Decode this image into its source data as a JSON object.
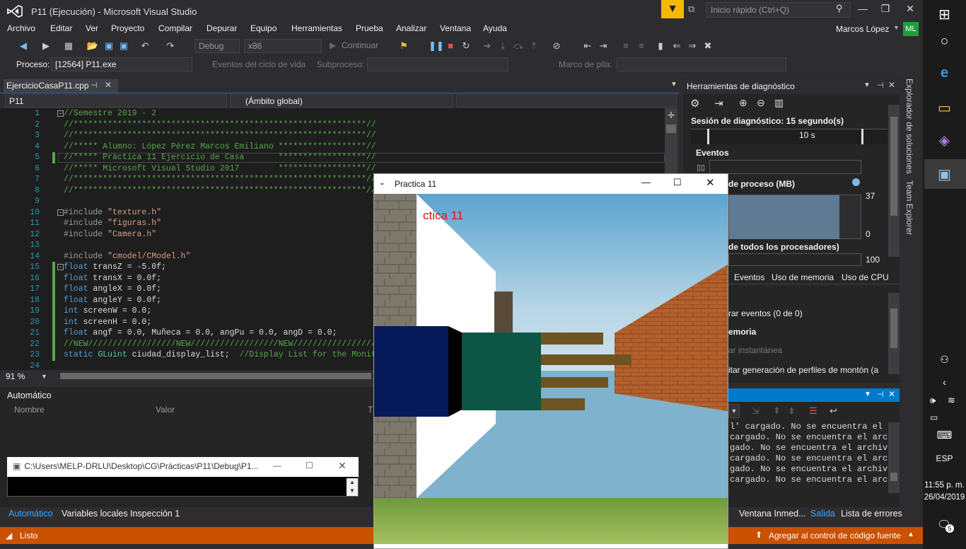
{
  "window": {
    "title": "P11 (Ejecución) - Microsoft Visual Studio",
    "quick_launch_placeholder": "Inicio rápido (Ctrl+Q)",
    "user": "Marcos López",
    "user_initials": "ML"
  },
  "menu": [
    "Archivo",
    "Editar",
    "Ver",
    "Proyecto",
    "Compilar",
    "Depurar",
    "Equipo",
    "Herramientas",
    "Prueba",
    "Analizar",
    "Ventana",
    "Ayuda"
  ],
  "toolbar": {
    "config": "Debug",
    "platform": "x86",
    "continue": "Continuar"
  },
  "process_bar": {
    "process_label": "Proceso:",
    "process_value": "[12564] P11.exe",
    "lifecycle": "Eventos del ciclo de vida",
    "thread_label": "Subproceso:",
    "stack_label": "Marco de pila:"
  },
  "editor": {
    "tab": "EjercicioCasaP11.cpp",
    "project": "P11",
    "scope": "(Ámbito global)",
    "zoom": "91 %",
    "lines": [
      {
        "n": "1",
        "t": "//Semestre 2019 - 2"
      },
      {
        "n": "2",
        "t": "//************************************************************//"
      },
      {
        "n": "3",
        "t": "//************************************************************//"
      },
      {
        "n": "4",
        "t": "//***** Alumno: López Pérez Marcos Emiliano ******************//"
      },
      {
        "n": "5",
        "t": "//***** Práctica 11 Ejercicio de Casa       ******************//"
      },
      {
        "n": "6",
        "t": "//***** Microsoft Visual Studio 2017        ******************//"
      },
      {
        "n": "7",
        "t": "//************************************************************//"
      },
      {
        "n": "8",
        "t": "//************************************************************//"
      },
      {
        "n": "9",
        "t": ""
      },
      {
        "n": "10",
        "t": "#include \"texture.h\""
      },
      {
        "n": "11",
        "t": "#include \"figuras.h\""
      },
      {
        "n": "12",
        "t": "#include \"Camera.h\""
      },
      {
        "n": "13",
        "t": ""
      },
      {
        "n": "14",
        "t": "#include \"cmodel/CModel.h\""
      },
      {
        "n": "15",
        "t": "float transZ = -5.0f;"
      },
      {
        "n": "16",
        "t": "float transX = 0.0f;"
      },
      {
        "n": "17",
        "t": "float angleX = 0.0f;"
      },
      {
        "n": "18",
        "t": "float angleY = 0.0f;"
      },
      {
        "n": "19",
        "t": "int screenW = 0.0;"
      },
      {
        "n": "20",
        "t": "int screenH = 0.0;"
      },
      {
        "n": "21",
        "t": "float angf = 0.0, Muñeca = 0.0, angPu = 0.0, angD = 0.0;"
      },
      {
        "n": "22",
        "t": "//NEW//////////////////NEW//////////////////NEW//////////////////NEW"
      },
      {
        "n": "23",
        "t": "static GLuint ciudad_display_list;  //Display List for the Monito"
      },
      {
        "n": "24",
        "t": ""
      }
    ]
  },
  "autos": {
    "title": "Automático",
    "col_name": "Nombre",
    "col_value": "Valor",
    "col_type": "T"
  },
  "console": {
    "title": "C:\\Users\\MELP-DRLU\\Desktop\\CG\\Prácticas\\P11\\Debug\\P1..."
  },
  "bottom_tabs_left": [
    "Automático",
    "Variables locales",
    "Inspección 1"
  ],
  "bottom_tabs_right": [
    "Ventana Inmed...",
    "Salida",
    "Lista de errores"
  ],
  "status": {
    "left": "Listo",
    "right": "Agregar al control de código fuente"
  },
  "diag": {
    "title": "Herramientas de diagnóstico",
    "session": "Sesión de diagnóstico: 15 segundo(s)",
    "tick": "10 s",
    "events": "Eventos",
    "memory": "de proceso (MB)",
    "mem_max": "37",
    "mem_min": "0",
    "cpu": "de todos los procesadores)",
    "cpu_max": "100",
    "tabs": [
      "Eventos",
      "Uso de memoria",
      "Uso de CPU"
    ],
    "show_events": "rar eventos (0 de 0)",
    "mem_section": "emoria",
    "snapshot": "ar instantánea",
    "heap": "itar generación de perfiles de montón (a"
  },
  "output_lines": [
    "l' cargado. No se encuentra el a",
    "cargado. No se encuentra el archi",
    "gado. No se encuentra el archivo",
    "cargado. No se encuentra el archi",
    "gado. No se encuentra el archivo",
    "cargado. No se encuentra el archi"
  ],
  "side_panels": [
    "Explorador de soluciones",
    "Team Explorer"
  ],
  "gl_window": {
    "title": "Practica 11",
    "overlay": "ctica 11"
  },
  "taskbar": {
    "lang": "ESP",
    "time": "11:55 p. m.",
    "date": "26/04/2019",
    "notif": "5"
  },
  "colors": {
    "accent": "#007acc",
    "status": "#ca5100",
    "code_comment": "#57a64a",
    "keyword": "#569cd6",
    "string": "#d69d85"
  }
}
